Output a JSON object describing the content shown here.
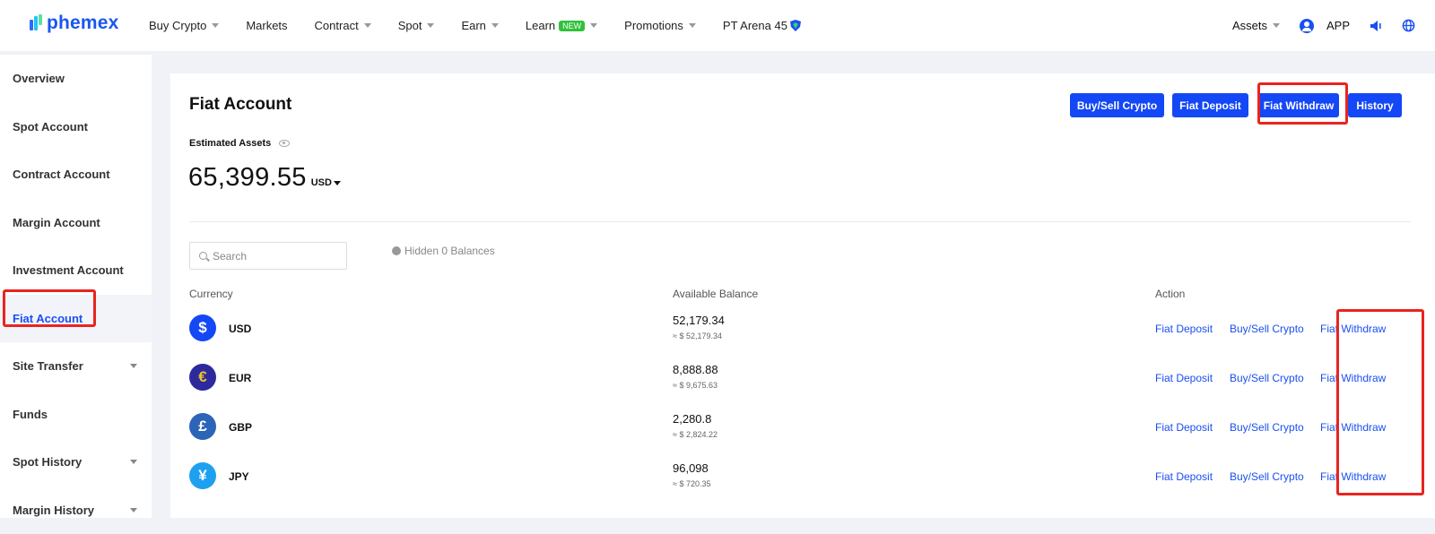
{
  "brand": {
    "logo_text": "phemex"
  },
  "nav": {
    "items": [
      {
        "label": "Buy Crypto",
        "has_caret": true
      },
      {
        "label": "Markets",
        "has_caret": false
      },
      {
        "label": "Contract",
        "has_caret": true
      },
      {
        "label": "Spot",
        "has_caret": true
      },
      {
        "label": "Earn",
        "has_caret": true
      },
      {
        "label": "Learn",
        "has_caret": true,
        "badge": "NEW"
      },
      {
        "label": "Promotions",
        "has_caret": true
      },
      {
        "label": "PT Arena 45",
        "has_caret": false
      }
    ],
    "right": {
      "assets": "Assets",
      "app": "APP"
    }
  },
  "sidebar": {
    "items": [
      {
        "label": "Overview"
      },
      {
        "label": "Spot Account"
      },
      {
        "label": "Contract Account"
      },
      {
        "label": "Margin Account"
      },
      {
        "label": "Investment Account"
      },
      {
        "label": "Fiat Account",
        "active": true
      },
      {
        "label": "Site Transfer",
        "expandable": true
      },
      {
        "label": "Funds"
      },
      {
        "label": "Spot History",
        "expandable": true
      },
      {
        "label": "Margin History",
        "expandable": true
      }
    ]
  },
  "main": {
    "title": "Fiat Account",
    "buttons": {
      "buy_sell": "Buy/Sell Crypto",
      "deposit": "Fiat Deposit",
      "withdraw": "Fiat Withdraw",
      "history": "History"
    },
    "estimated_label": "Estimated Assets",
    "total_value": "65,399.55",
    "total_currency": "USD",
    "search_placeholder": "Search",
    "hidden_balances": "Hidden 0 Balances",
    "columns": {
      "currency": "Currency",
      "balance": "Available Balance",
      "action": "Action"
    },
    "rows": [
      {
        "symbol_glyph": "$",
        "currency": "USD",
        "balance": "52,179.34",
        "usd_value": "≈ $ 52,179.34"
      },
      {
        "symbol_glyph": "€",
        "currency": "EUR",
        "balance": "8,888.88",
        "usd_value": "≈ $ 9,675.63"
      },
      {
        "symbol_glyph": "£",
        "currency": "GBP",
        "balance": "2,280.8",
        "usd_value": "≈ $ 2,824.22"
      },
      {
        "symbol_glyph": "¥",
        "currency": "JPY",
        "balance": "96,098",
        "usd_value": "≈ $ 720.35"
      }
    ],
    "row_actions": {
      "deposit": "Fiat Deposit",
      "buy_sell": "Buy/Sell Crypto",
      "withdraw": "Fiat Withdraw"
    }
  },
  "colors": {
    "accent": "#1447f5",
    "highlight_box": "#e8241f",
    "usd_icon": "#1447f5",
    "eur_icon": "#2d2a9e",
    "eur_symbol": "#f3c623",
    "gbp_icon": "#2c64b8",
    "jpy_icon": "#1ea0f0"
  }
}
